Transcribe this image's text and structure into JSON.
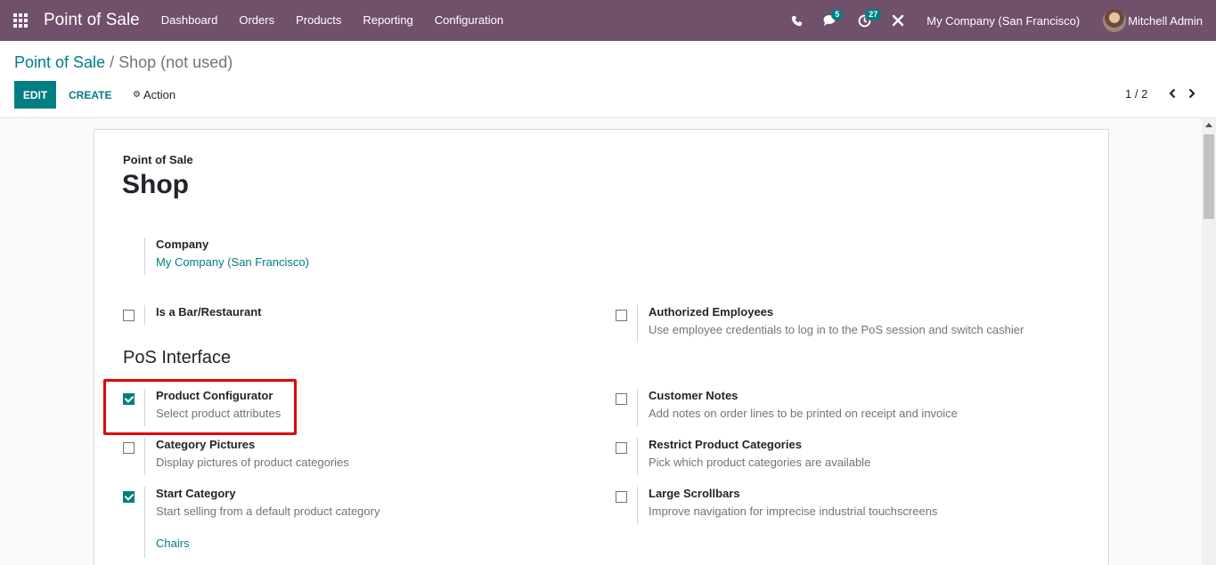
{
  "navbar": {
    "brand": "Point of Sale",
    "menu": [
      "Dashboard",
      "Orders",
      "Products",
      "Reporting",
      "Configuration"
    ],
    "messages_count": "5",
    "activities_count": "27",
    "company": "My Company (San Francisco)",
    "user": "Mitchell Admin"
  },
  "breadcrumb": {
    "parent": "Point of Sale",
    "separator": "/",
    "current": "Shop (not used)"
  },
  "toolbar": {
    "edit_label": "EDIT",
    "create_label": "CREATE",
    "action_label": "Action"
  },
  "pager": {
    "value": "1 / 2"
  },
  "form": {
    "app_label": "Point of Sale",
    "name": "Shop",
    "company_label": "Company",
    "company_value": "My Company (San Francisco)",
    "section_pos_interface": "PoS Interface",
    "settings": {
      "is_bar": {
        "title": "Is a Bar/Restaurant",
        "checked": false
      },
      "authorized_employees": {
        "title": "Authorized Employees",
        "desc": "Use employee credentials to log in to the PoS session and switch cashier",
        "checked": false
      },
      "product_configurator": {
        "title": "Product Configurator",
        "desc": "Select product attributes",
        "checked": true
      },
      "customer_notes": {
        "title": "Customer Notes",
        "desc": "Add notes on order lines to be printed on receipt and invoice",
        "checked": false
      },
      "category_pictures": {
        "title": "Category Pictures",
        "desc": "Display pictures of product categories",
        "checked": false
      },
      "restrict_categories": {
        "title": "Restrict Product Categories",
        "desc": "Pick which product categories are available",
        "checked": false
      },
      "start_category": {
        "title": "Start Category",
        "desc": "Start selling from a default product category",
        "value": "Chairs",
        "checked": true
      },
      "large_scrollbars": {
        "title": "Large Scrollbars",
        "desc": "Improve navigation for imprecise industrial touchscreens",
        "checked": false
      }
    }
  },
  "colors": {
    "navbar": "#71506b",
    "accent": "#017e84",
    "highlight": "#e00000"
  }
}
